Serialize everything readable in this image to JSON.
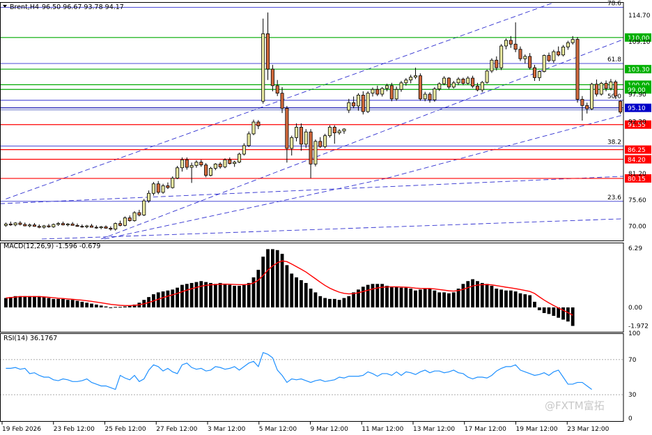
{
  "header": {
    "symbol_title": "Brent,H4",
    "ohlc": "96.50 96.67 93.78 94.17"
  },
  "watermark": "@FXTM富拓",
  "colors": {
    "bull": "#e8e8a0",
    "bear": "#d2693c",
    "support": "#ff0000",
    "resistance": "#00aa00",
    "channel": "#3030d0",
    "price_line": "#0000aa",
    "macd_signal": "#ff0000",
    "rsi_line": "#1e90ff",
    "tag_green": "#00b000",
    "tag_red": "#ff0000",
    "tag_blue": "#0000c8"
  },
  "chart_data": [
    {
      "type": "candlestick",
      "name": "price",
      "y_range": [
        67.0,
        117.5
      ],
      "y_ticks": [
        "114.70",
        "109.10",
        "97.90",
        "92.20",
        "81.20",
        "75.60",
        "70.00"
      ],
      "x_labels": [
        "19 Feb 2026",
        "23 Feb 12:00",
        "25 Feb 12:00",
        "27 Feb 12:00",
        "3 Mar 12:00",
        "5 Mar 12:00",
        "9 Mar 12:00",
        "11 Mar 12:00",
        "13 Mar 12:00",
        "17 Mar 12:00",
        "19 Mar 12:00",
        "23 Mar 12:00"
      ],
      "levels": [
        {
          "value": 110.0,
          "label": "110.00",
          "kind": "resistance"
        },
        {
          "value": 103.3,
          "label": "103.30",
          "kind": "resistance"
        },
        {
          "value": 100.0,
          "label": "100.00",
          "kind": "resistance"
        },
        {
          "value": 99.0,
          "label": "99.00",
          "kind": "resistance"
        },
        {
          "value": 95.1,
          "label": "95.10",
          "kind": "price"
        },
        {
          "value": 91.55,
          "label": "91.55",
          "kind": "support"
        },
        {
          "value": 86.25,
          "label": "86.25",
          "kind": "support"
        },
        {
          "value": 84.2,
          "label": "84.20",
          "kind": "support"
        },
        {
          "value": 80.15,
          "label": "80.15",
          "kind": "support"
        }
      ],
      "fibo": [
        {
          "value": 116.4,
          "label": "78.6"
        },
        {
          "value": 104.5,
          "label": "61.8"
        },
        {
          "value": 96.7,
          "label": "50.0"
        },
        {
          "value": 87.0,
          "label": "38.2"
        },
        {
          "value": 75.3,
          "label": "23.6"
        }
      ],
      "ohlc": [
        [
          70.2,
          70.8,
          69.9,
          70.5
        ],
        [
          70.5,
          71.0,
          70.1,
          70.3
        ],
        [
          70.3,
          70.9,
          70.0,
          70.7
        ],
        [
          70.7,
          71.1,
          70.2,
          70.4
        ],
        [
          70.4,
          70.8,
          70.0,
          70.1
        ],
        [
          70.1,
          70.6,
          69.8,
          70.3
        ],
        [
          70.3,
          70.7,
          69.9,
          70.0
        ],
        [
          70.0,
          70.4,
          69.6,
          69.8
        ],
        [
          69.8,
          70.3,
          69.5,
          70.1
        ],
        [
          70.1,
          70.5,
          69.7,
          69.9
        ],
        [
          69.9,
          70.6,
          69.7,
          70.4
        ],
        [
          70.4,
          70.9,
          70.1,
          70.6
        ],
        [
          70.6,
          71.0,
          70.2,
          70.3
        ],
        [
          70.3,
          70.7,
          70.0,
          70.5
        ],
        [
          70.5,
          70.9,
          70.2,
          70.2
        ],
        [
          70.2,
          70.6,
          69.9,
          70.0
        ],
        [
          70.0,
          70.4,
          69.7,
          69.9
        ],
        [
          69.9,
          70.3,
          69.6,
          70.1
        ],
        [
          70.1,
          70.5,
          69.8,
          69.8
        ],
        [
          69.8,
          70.2,
          69.5,
          69.7
        ],
        [
          69.7,
          70.1,
          69.4,
          69.9
        ],
        [
          69.9,
          70.2,
          69.5,
          69.6
        ],
        [
          69.6,
          70.0,
          69.1,
          69.4
        ],
        [
          69.4,
          70.8,
          69.1,
          70.6
        ],
        [
          70.6,
          71.2,
          70.0,
          70.2
        ],
        [
          70.2,
          72.1,
          70.0,
          71.8
        ],
        [
          71.8,
          72.3,
          71.0,
          71.2
        ],
        [
          71.2,
          73.2,
          71.0,
          72.9
        ],
        [
          72.9,
          73.5,
          72.1,
          72.4
        ],
        [
          72.4,
          75.8,
          72.2,
          75.4
        ],
        [
          75.4,
          77.6,
          75.0,
          77.0
        ],
        [
          77.0,
          79.4,
          76.5,
          79.0
        ],
        [
          79.0,
          79.6,
          76.8,
          77.2
        ],
        [
          77.2,
          79.0,
          76.9,
          78.6
        ],
        [
          78.6,
          79.3,
          77.9,
          78.2
        ],
        [
          78.2,
          80.6,
          78.0,
          80.2
        ],
        [
          80.2,
          82.8,
          80.0,
          82.4
        ],
        [
          82.4,
          84.6,
          81.6,
          84.1
        ],
        [
          84.1,
          84.6,
          82.0,
          82.5
        ],
        [
          82.5,
          83.5,
          79.2,
          82.9
        ],
        [
          82.9,
          84.0,
          82.4,
          83.6
        ],
        [
          83.6,
          84.1,
          82.6,
          83.0
        ],
        [
          83.0,
          83.4,
          80.4,
          80.8
        ],
        [
          80.8,
          82.6,
          80.6,
          82.3
        ],
        [
          82.3,
          83.4,
          81.9,
          83.2
        ],
        [
          83.2,
          83.6,
          82.2,
          82.6
        ],
        [
          82.6,
          84.4,
          82.3,
          84.1
        ],
        [
          84.1,
          84.6,
          83.1,
          83.3
        ],
        [
          83.3,
          83.9,
          82.6,
          83.6
        ],
        [
          83.6,
          85.6,
          83.4,
          85.3
        ],
        [
          85.3,
          87.6,
          85.0,
          87.1
        ],
        [
          87.1,
          90.1,
          86.8,
          89.6
        ],
        [
          89.6,
          92.6,
          89.3,
          92.1
        ],
        [
          92.1,
          92.5,
          90.6,
          91.3
        ],
        [
          96.5,
          114.0,
          96.0,
          110.8
        ],
        [
          110.8,
          115.3,
          101.0,
          103.3
        ],
        [
          103.3,
          104.2,
          98.6,
          99.8
        ],
        [
          99.8,
          101.0,
          97.6,
          98.2
        ],
        [
          98.2,
          99.5,
          94.0,
          95.0
        ],
        [
          95.0,
          95.5,
          83.5,
          86.5
        ],
        [
          86.5,
          89.2,
          85.0,
          88.8
        ],
        [
          88.8,
          91.8,
          88.0,
          91.0
        ],
        [
          91.0,
          91.8,
          86.0,
          87.4
        ],
        [
          87.4,
          90.6,
          86.6,
          90.0
        ],
        [
          90.0,
          90.6,
          80.2,
          83.2
        ],
        [
          83.2,
          88.4,
          82.7,
          88.0
        ],
        [
          88.0,
          88.9,
          86.6,
          86.9
        ],
        [
          86.9,
          89.6,
          86.5,
          89.2
        ],
        [
          89.2,
          91.4,
          88.8,
          91.0
        ],
        [
          91.0,
          91.4,
          87.5,
          89.8
        ],
        [
          89.8,
          90.6,
          89.4,
          90.2
        ],
        [
          90.2,
          90.8,
          89.6,
          90.6
        ],
        [
          94.6,
          97.0,
          94.0,
          96.2
        ],
        [
          96.2,
          97.5,
          95.0,
          95.5
        ],
        [
          95.5,
          98.2,
          94.5,
          97.8
        ],
        [
          97.8,
          98.6,
          93.7,
          94.3
        ],
        [
          94.3,
          98.6,
          94.0,
          98.2
        ],
        [
          98.2,
          99.4,
          97.5,
          99.0
        ],
        [
          99.0,
          99.8,
          97.6,
          98.0
        ],
        [
          98.0,
          99.5,
          97.5,
          99.2
        ],
        [
          99.2,
          100.2,
          98.6,
          99.8
        ],
        [
          99.8,
          100.4,
          96.5,
          97.0
        ],
        [
          97.0,
          99.6,
          96.6,
          99.0
        ],
        [
          99.0,
          100.8,
          98.5,
          100.4
        ],
        [
          100.4,
          101.4,
          99.8,
          101.0
        ],
        [
          101.0,
          102.1,
          100.3,
          101.6
        ],
        [
          101.6,
          103.6,
          101.2,
          101.9
        ],
        [
          101.9,
          102.4,
          96.6,
          97.0
        ],
        [
          97.0,
          98.5,
          96.5,
          98.0
        ],
        [
          98.0,
          98.4,
          96.2,
          96.8
        ],
        [
          96.8,
          99.5,
          96.4,
          99.1
        ],
        [
          99.1,
          100.5,
          98.7,
          100.2
        ],
        [
          100.2,
          101.8,
          99.9,
          101.4
        ],
        [
          101.4,
          101.6,
          99.1,
          99.5
        ],
        [
          99.5,
          100.8,
          99.2,
          100.4
        ],
        [
          100.4,
          101.6,
          99.9,
          101.2
        ],
        [
          101.2,
          101.5,
          99.9,
          100.3
        ],
        [
          100.3,
          101.8,
          100.0,
          101.4
        ],
        [
          101.4,
          101.9,
          99.3,
          99.7
        ],
        [
          99.7,
          100.4,
          98.6,
          98.9
        ],
        [
          98.9,
          100.8,
          98.4,
          100.5
        ],
        [
          100.5,
          103.2,
          100.2,
          102.9
        ],
        [
          102.9,
          105.6,
          102.5,
          105.2
        ],
        [
          105.2,
          106.0,
          103.0,
          103.6
        ],
        [
          103.6,
          108.6,
          103.1,
          108.2
        ],
        [
          108.2,
          109.8,
          107.5,
          109.4
        ],
        [
          109.4,
          110.3,
          107.8,
          108.6
        ],
        [
          108.6,
          113.2,
          106.9,
          107.5
        ],
        [
          107.5,
          108.1,
          105.0,
          105.5
        ],
        [
          105.5,
          106.4,
          104.5,
          106.0
        ],
        [
          106.0,
          106.7,
          103.2,
          103.6
        ],
        [
          103.6,
          104.2,
          100.8,
          101.5
        ],
        [
          101.5,
          103.0,
          100.8,
          102.8
        ],
        [
          102.8,
          106.4,
          102.6,
          106.2
        ],
        [
          106.2,
          106.8,
          104.8,
          105.1
        ],
        [
          105.1,
          107.4,
          104.6,
          107.0
        ],
        [
          107.0,
          108.1,
          106.0,
          106.3
        ],
        [
          106.3,
          108.4,
          106.0,
          108.0
        ],
        [
          108.0,
          109.3,
          107.4,
          108.9
        ],
        [
          108.9,
          110.3,
          108.5,
          109.6
        ],
        [
          109.6,
          110.1,
          96.2,
          96.9
        ],
        [
          96.9,
          97.6,
          92.4,
          95.6
        ],
        [
          95.6,
          96.2,
          93.9,
          94.9
        ],
        [
          94.9,
          100.4,
          94.6,
          100.1
        ],
        [
          100.1,
          101.1,
          97.5,
          98.0
        ],
        [
          98.0,
          100.6,
          97.7,
          100.3
        ],
        [
          100.3,
          100.9,
          98.6,
          99.2
        ],
        [
          99.2,
          101.2,
          98.8,
          100.6
        ],
        [
          100.6,
          101.0,
          97.0,
          97.6
        ],
        [
          96.5,
          96.7,
          93.8,
          94.2
        ]
      ]
    },
    {
      "type": "bar",
      "name": "macd",
      "title": "MACD(12,26,9) -1.596 -0.679",
      "y_range": [
        -2.6,
        6.9
      ],
      "y_ticks": [
        "6.29",
        "0.00",
        "-1.972"
      ],
      "histogram": [
        1.0,
        1.1,
        1.2,
        1.2,
        1.2,
        1.2,
        1.2,
        1.2,
        1.1,
        1.0,
        0.9,
        0.9,
        0.9,
        0.8,
        0.8,
        0.7,
        0.6,
        0.5,
        0.4,
        0.3,
        0.2,
        0.1,
        0.0,
        0.05,
        0.05,
        0.1,
        0.2,
        0.3,
        0.5,
        0.8,
        1.1,
        1.4,
        1.6,
        1.7,
        1.8,
        1.9,
        2.1,
        2.4,
        2.5,
        2.6,
        2.7,
        2.8,
        2.7,
        2.6,
        2.5,
        2.6,
        2.5,
        2.4,
        2.3,
        2.3,
        2.4,
        2.6,
        3.2,
        4.0,
        5.4,
        6.2,
        6.2,
        6.1,
        5.7,
        4.5,
        3.6,
        3.2,
        2.9,
        2.6,
        2.0,
        1.6,
        1.2,
        1.0,
        0.9,
        0.9,
        0.8,
        1.0,
        1.2,
        1.6,
        1.9,
        2.2,
        2.4,
        2.5,
        2.5,
        2.5,
        2.3,
        2.2,
        2.2,
        2.1,
        2.1,
        2.0,
        1.8,
        1.9,
        2.0,
        2.0,
        1.8,
        1.6,
        1.6,
        1.5,
        1.6,
        2.0,
        2.5,
        2.8,
        3.0,
        2.8,
        2.6,
        2.5,
        2.3,
        2.0,
        1.9,
        1.8,
        1.8,
        1.7,
        1.5,
        1.4,
        1.3,
        0.6,
        -0.3,
        -0.6,
        -0.7,
        -0.9,
        -1.1,
        -1.3,
        -1.5,
        -1.97
      ],
      "signal": [
        1.0,
        1.05,
        1.1,
        1.15,
        1.15,
        1.15,
        1.15,
        1.15,
        1.12,
        1.08,
        1.03,
        0.98,
        0.95,
        0.9,
        0.86,
        0.82,
        0.77,
        0.71,
        0.64,
        0.57,
        0.49,
        0.41,
        0.33,
        0.27,
        0.22,
        0.2,
        0.2,
        0.22,
        0.28,
        0.38,
        0.52,
        0.69,
        0.87,
        1.04,
        1.2,
        1.34,
        1.49,
        1.67,
        1.84,
        1.99,
        2.13,
        2.26,
        2.35,
        2.41,
        2.43,
        2.47,
        2.48,
        2.47,
        2.44,
        2.42,
        2.42,
        2.46,
        2.6,
        2.9,
        3.4,
        3.97,
        4.41,
        4.75,
        4.95,
        4.87,
        4.62,
        4.34,
        4.06,
        3.77,
        3.41,
        3.05,
        2.68,
        2.34,
        2.05,
        1.82,
        1.62,
        1.5,
        1.44,
        1.47,
        1.56,
        1.69,
        1.83,
        1.96,
        2.07,
        2.15,
        2.18,
        2.19,
        2.19,
        2.17,
        2.15,
        2.12,
        2.05,
        2.02,
        2.01,
        2.01,
        1.97,
        1.9,
        1.84,
        1.77,
        1.74,
        1.79,
        1.93,
        2.1,
        2.28,
        2.38,
        2.42,
        2.43,
        2.4,
        2.32,
        2.24,
        2.15,
        2.08,
        2.0,
        1.9,
        1.8,
        1.7,
        1.48,
        1.12,
        0.78,
        0.48,
        0.2,
        -0.06,
        -0.31,
        -0.55,
        -0.83
      ]
    },
    {
      "type": "line",
      "name": "rsi",
      "title": "RSI(14) 36.1767",
      "y_range": [
        0,
        100
      ],
      "y_ticks": [
        "100",
        "70",
        "30",
        "0"
      ],
      "levels": [
        70,
        30
      ],
      "values": [
        60,
        60,
        61,
        59,
        60,
        54,
        55,
        52,
        50,
        50,
        47,
        46,
        48,
        47,
        45,
        45,
        46,
        48,
        44,
        42,
        40,
        40,
        38,
        36,
        52,
        49,
        47,
        52,
        45,
        48,
        58,
        64,
        62,
        57,
        60,
        56,
        54,
        64,
        66,
        61,
        59,
        60,
        57,
        58,
        62,
        61,
        59,
        60,
        62,
        58,
        62,
        66,
        68,
        62,
        78,
        76,
        72,
        58,
        52,
        44,
        48,
        47,
        48,
        46,
        44,
        46,
        47,
        45,
        46,
        47,
        50,
        49,
        51,
        51,
        51,
        52,
        56,
        54,
        51,
        54,
        54,
        52,
        56,
        52,
        56,
        55,
        53,
        56,
        58,
        55,
        57,
        57,
        55,
        56,
        58,
        55,
        54,
        50,
        48,
        50,
        50,
        49,
        52,
        57,
        60,
        62,
        62,
        64,
        58,
        56,
        54,
        52,
        53,
        55,
        52,
        56,
        58,
        50,
        42,
        42,
        44,
        44,
        40,
        36
      ]
    }
  ]
}
